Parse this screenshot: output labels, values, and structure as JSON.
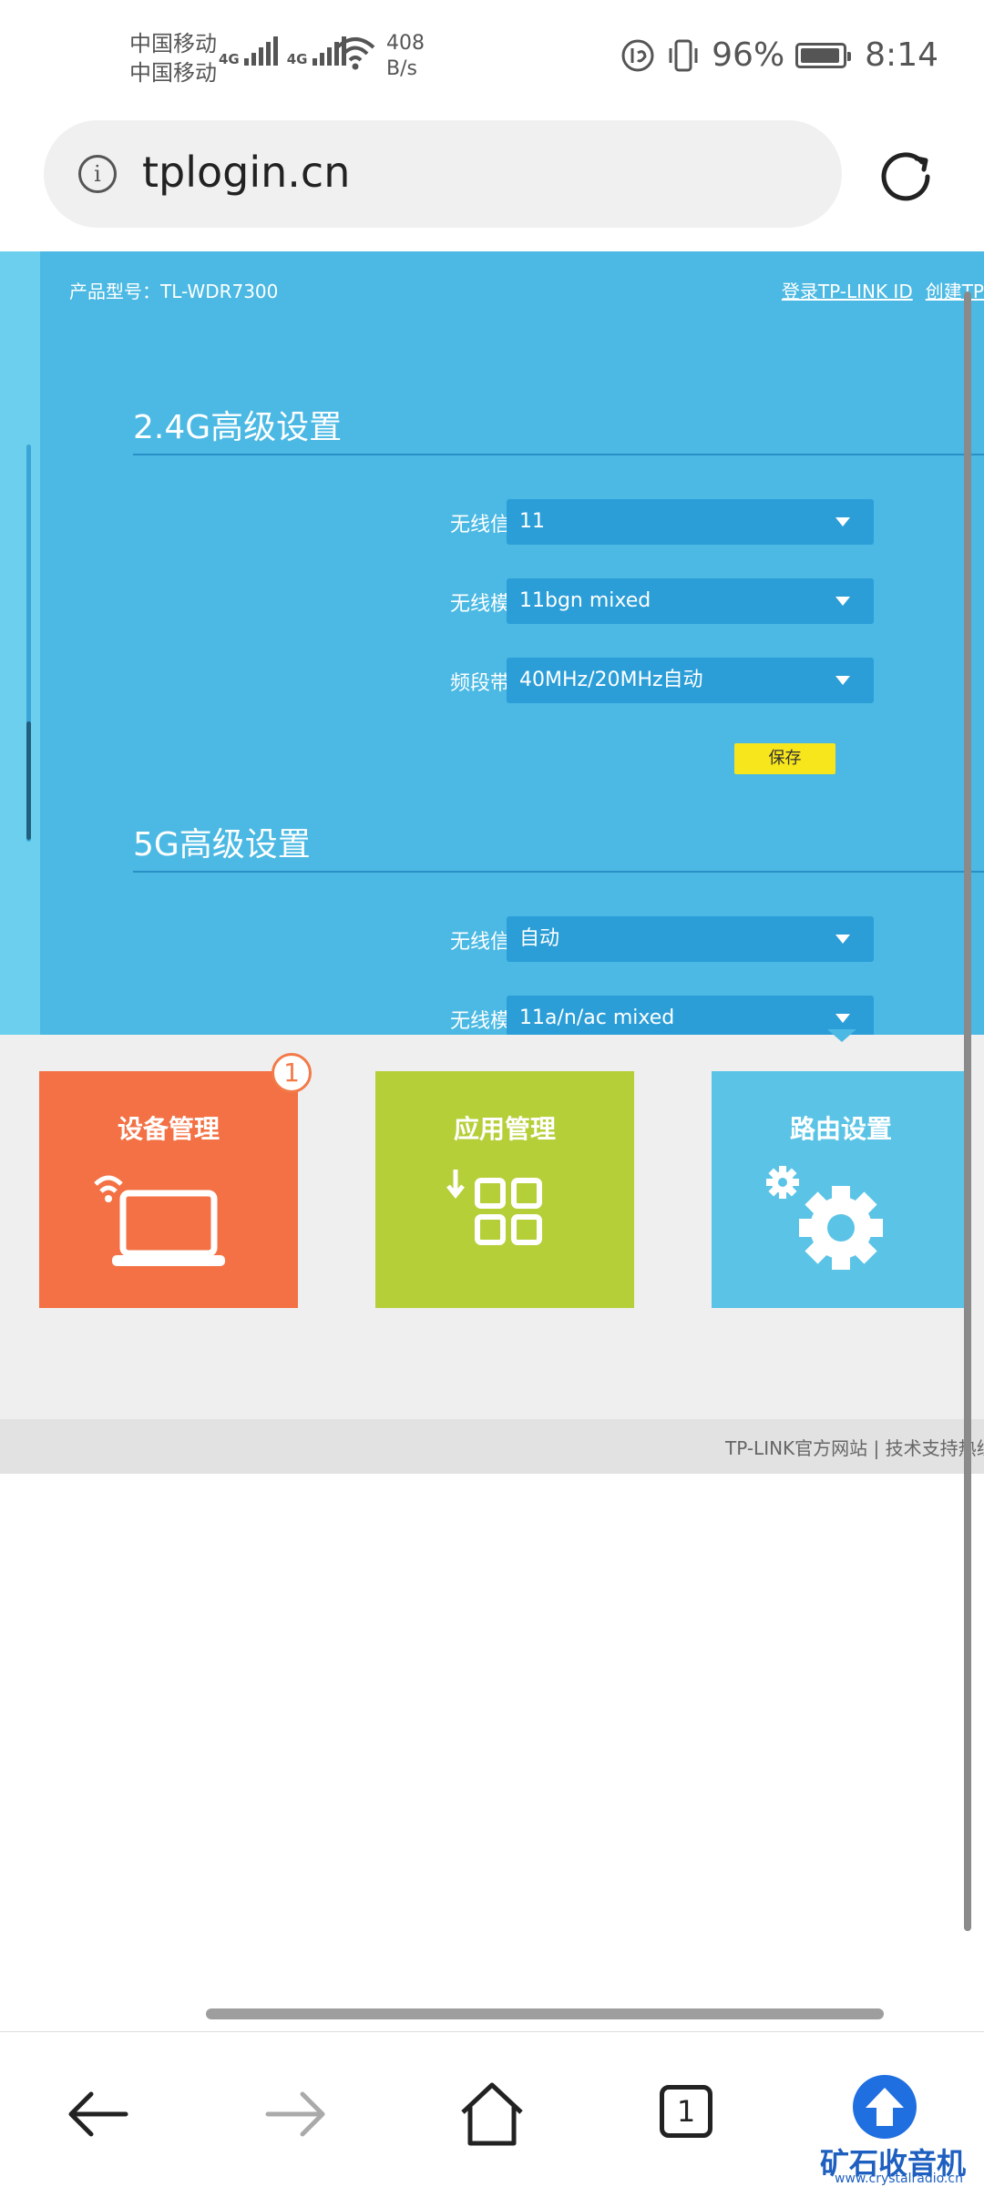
{
  "status_bar": {
    "carrier1": "中国移动",
    "carrier2": "中国移动",
    "network_type": "4G",
    "speed_value": "408",
    "speed_unit": "B/s",
    "battery": "96%",
    "time": "8:14"
  },
  "browser": {
    "url": "tplogin.cn",
    "tab_count": "1"
  },
  "router": {
    "model": "产品型号：TL-WDR7300",
    "links": [
      "登录TP-LINK ID",
      "创建TP"
    ],
    "section_24": {
      "title": "2.4G高级设置",
      "rows": [
        {
          "label": "无线信道",
          "value": "11"
        },
        {
          "label": "无线模式",
          "value": "11bgn mixed"
        },
        {
          "label": "频段带宽",
          "value": "40MHz/20MHz自动"
        }
      ],
      "save_label": "保存"
    },
    "section_5": {
      "title": "5G高级设置",
      "rows": [
        {
          "label": "无线信道",
          "value": "自动"
        },
        {
          "label": "无线模式",
          "value": "11a/n/ac mixed"
        }
      ]
    }
  },
  "tiles": [
    {
      "title": "设备管理",
      "color": "#f37144",
      "badge": "1"
    },
    {
      "title": "应用管理",
      "color": "#b5cf38"
    },
    {
      "title": "路由设置",
      "color": "#5bc4e6"
    }
  ],
  "footer": {
    "text": "TP-LINK官方网站  |  技术支持热线"
  },
  "watermark": {
    "title": "矿石收音机",
    "url": "www.crystalradio.cn"
  }
}
